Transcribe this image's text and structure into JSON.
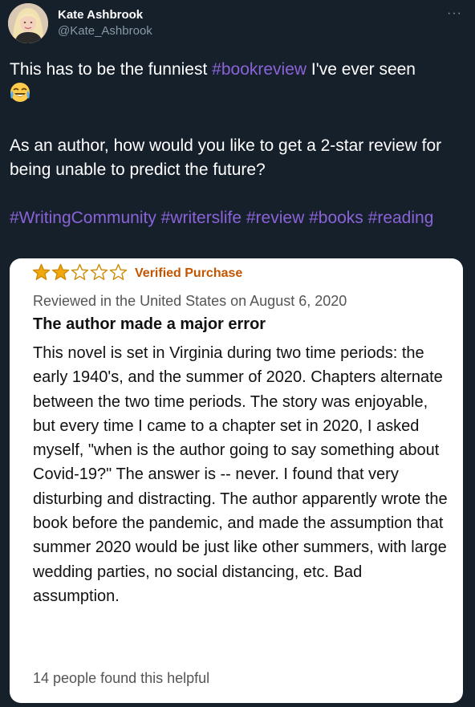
{
  "user": {
    "name": "Kate Ashbrook",
    "handle": "@Kate_Ashbrook"
  },
  "menu": {
    "more_label": "···"
  },
  "tweet": {
    "line1_before": "This has to be the funniest ",
    "line1_hashtag": "#bookreview",
    "line1_after": " I've ever seen",
    "emoji_icon": "face-with-tears-of-joy",
    "line2": "As an author, how would you like to get a 2-star review for being unable to predict the future?",
    "hashtags": [
      "#WritingCommunity",
      "#writerslife",
      "#review",
      "#books",
      "#reading"
    ]
  },
  "review": {
    "rating": 2,
    "max_rating": 5,
    "star_color": "#f0a80f",
    "verified_label": "Verified Purchase",
    "reviewed_on": "Reviewed in the United States on August 6, 2020",
    "title": "The author made a major error",
    "body": "This novel is set in Virginia during two time periods: the early 1940's, and the summer of 2020. Chapters alternate between the two time periods. The story was enjoyable, but every time I came to a chapter set in 2020, I asked myself, \"when is the author going to say something about Covid-19?\" The answer is -- never. I found that very disturbing and distracting. The author apparently wrote the book before the pandemic, and made the assumption that summer 2020 would be just like other summers, with large wedding parties, no social distancing, etc. Bad assumption.",
    "helpful_text": "14 people found this helpful"
  },
  "colors": {
    "background": "#15202b",
    "hashtag": "#8b63d8",
    "verified": "#c45500"
  }
}
